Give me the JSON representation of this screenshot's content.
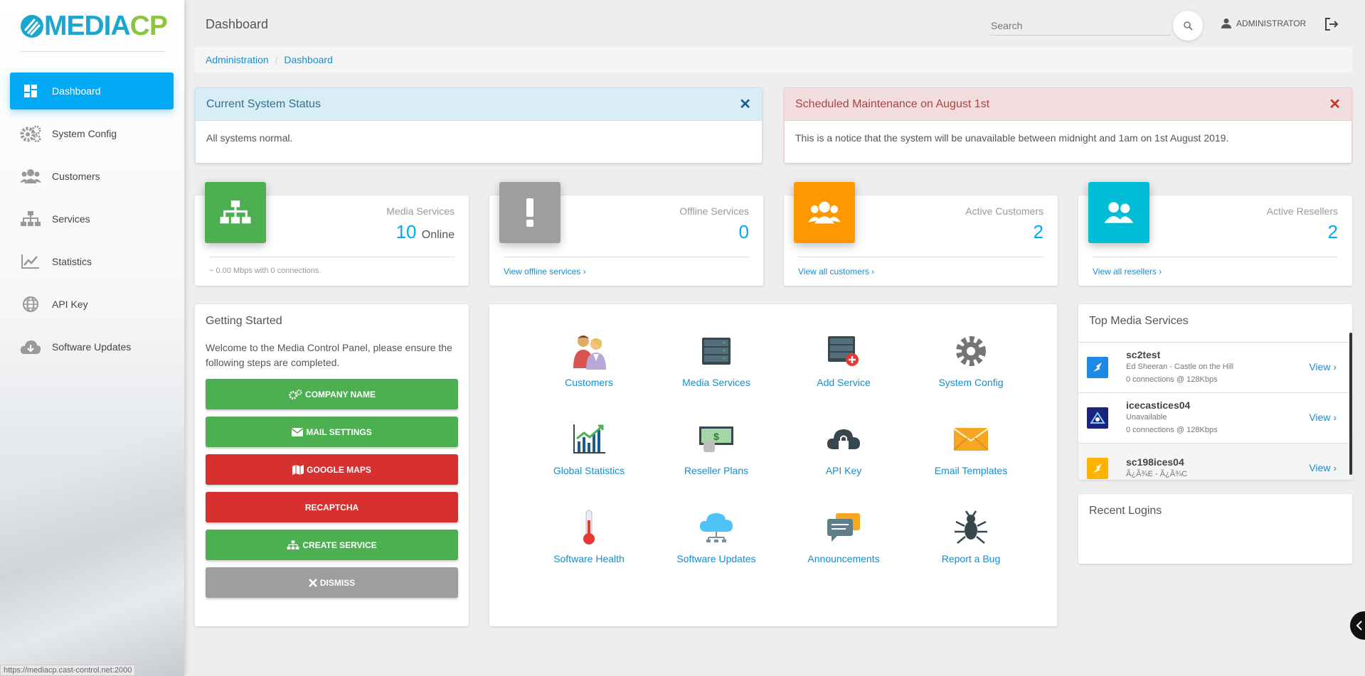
{
  "app": {
    "logo_media": "MEDIA",
    "logo_cp": "CP",
    "page_title": "Dashboard",
    "status_url": "https://mediacp.cast-control.net:2000"
  },
  "sidebar": {
    "items": [
      {
        "label": "Dashboard",
        "icon": "dashboard-icon"
      },
      {
        "label": "System Config",
        "icon": "gears-icon"
      },
      {
        "label": "Customers",
        "icon": "users-icon"
      },
      {
        "label": "Services",
        "icon": "sitemap-icon"
      },
      {
        "label": "Statistics",
        "icon": "chart-icon"
      },
      {
        "label": "API Key",
        "icon": "globe-icon"
      },
      {
        "label": "Software Updates",
        "icon": "cloud-download-icon"
      }
    ]
  },
  "header": {
    "search_placeholder": "Search",
    "user": "ADMINISTRATOR"
  },
  "breadcrumb": {
    "items": [
      "Administration",
      "Dashboard"
    ],
    "separator": "/"
  },
  "alerts": [
    {
      "title": "Current System Status",
      "body": "All systems normal.",
      "close": "✕"
    },
    {
      "title": "Scheduled Maintenance on August 1st",
      "body": "This is a notice that the system will be unavailable between midnight and 1am on 1st August 2019.",
      "close": "✕"
    }
  ],
  "stats": [
    {
      "category": "Media Services",
      "value": "10",
      "suffix": "Online",
      "footer": "~ 0.00 Mbps with 0 connections.",
      "color": "#4caf50"
    },
    {
      "category": "Offline Services",
      "value": "0",
      "footer_link": "View offline services",
      "color": "#9e9e9e"
    },
    {
      "category": "Active Customers",
      "value": "2",
      "footer_link": "View all customers",
      "color": "#ff9800"
    },
    {
      "category": "Active Resellers",
      "value": "2",
      "footer_link": "View all resellers",
      "color": "#00bcd4"
    }
  ],
  "getting_started": {
    "title": "Getting Started",
    "text": "Welcome to the Media Control Panel, please ensure the following steps are completed.",
    "buttons": [
      {
        "label": "COMPANY NAME",
        "color": "green",
        "icon": "gears-icon"
      },
      {
        "label": "MAIL SETTINGS",
        "color": "green",
        "icon": "envelope-icon"
      },
      {
        "label": "GOOGLE MAPS",
        "color": "red",
        "icon": "map-icon"
      },
      {
        "label": "RECAPTCHA",
        "color": "red",
        "icon": ""
      },
      {
        "label": "CREATE SERVICE",
        "color": "green",
        "icon": "sitemap-icon"
      },
      {
        "label": "DISMISS",
        "color": "gray",
        "icon": "close-icon"
      }
    ]
  },
  "shortcuts": [
    {
      "label": "Customers",
      "icon": "people-icon"
    },
    {
      "label": "Media Services",
      "icon": "server-icon"
    },
    {
      "label": "Add Service",
      "icon": "server-add-icon"
    },
    {
      "label": "System Config",
      "icon": "gear-icon"
    },
    {
      "label": "Global Statistics",
      "icon": "chart-icon"
    },
    {
      "label": "Reseller Plans",
      "icon": "money-icon"
    },
    {
      "label": "API Key",
      "icon": "cloud-lock-icon"
    },
    {
      "label": "Email Templates",
      "icon": "envelope-icon"
    },
    {
      "label": "Software Health",
      "icon": "thermometer-icon"
    },
    {
      "label": "Software Updates",
      "icon": "cloud-network-icon"
    },
    {
      "label": "Announcements",
      "icon": "chat-icon"
    },
    {
      "label": "Report a Bug",
      "icon": "bug-icon"
    }
  ],
  "top_media": {
    "title": "Top Media Services",
    "rows": [
      {
        "name": "sc2test",
        "track": "Ed Sheeran - Castle on the Hill",
        "stats": "0 connections @ 128Kbps",
        "view": "View"
      },
      {
        "name": "icecastices04",
        "track": "Unavailable",
        "stats": "0 connections @ 128Kbps",
        "view": "View"
      },
      {
        "name": "sc198ices04",
        "track": "Ã¿Ã¾E - Ã¿Ã¾C",
        "stats": "",
        "view": "View"
      }
    ]
  },
  "recent_logins": {
    "title": "Recent Logins"
  }
}
